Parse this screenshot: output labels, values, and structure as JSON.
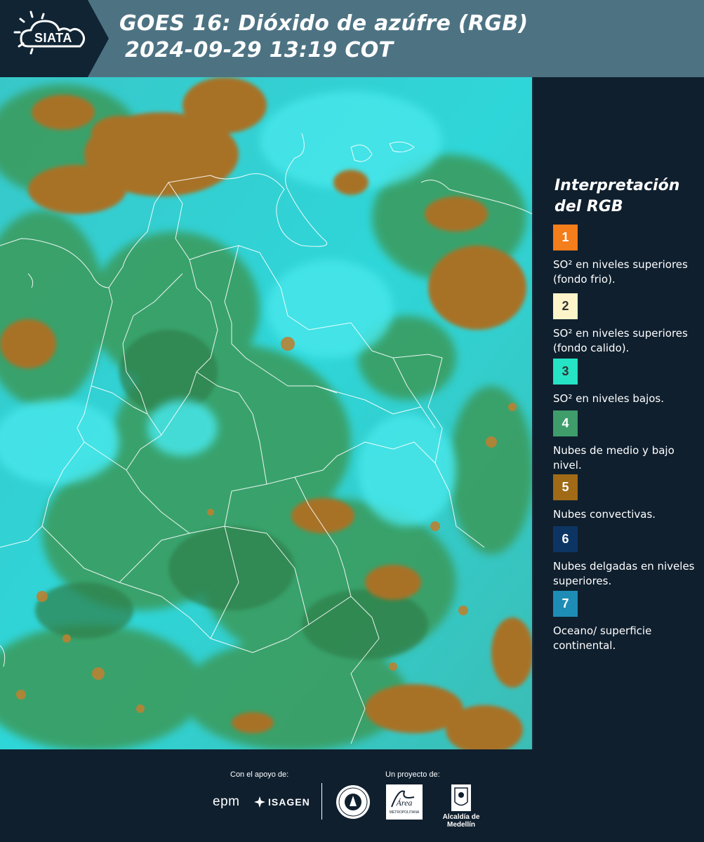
{
  "header": {
    "logo_text": "SIATA",
    "title": "GOES 16: Dióxido de azúfre (RGB)",
    "datetime": " 2024-09-29 13:19 COT"
  },
  "map": {
    "icon": "satellite-rgb-image"
  },
  "legend": {
    "title": "Interpretación del RGB",
    "items": [
      {
        "number": "1",
        "color": "#f47d1c",
        "text_color": "#ffffff",
        "label": "SO² en niveles superiores (fondo frio)."
      },
      {
        "number": "2",
        "color": "#fdf5c9",
        "text_color": "#333333",
        "label": "SO² en niveles superiores (fondo calido)."
      },
      {
        "number": "3",
        "color": "#25e3c4",
        "text_color": "#333333",
        "label": "SO² en niveles bajos."
      },
      {
        "number": "4",
        "color": "#3f9d6c",
        "text_color": "#ffffff",
        "label": "Nubes de medio y bajo nivel."
      },
      {
        "number": "5",
        "color": "#a06a17",
        "text_color": "#ffffff",
        "label": "Nubes convectivas."
      },
      {
        "number": "6",
        "color": "#0d3564",
        "text_color": "#ffffff",
        "label": "Nubes delgadas en niveles superiores."
      },
      {
        "number": "7",
        "color": "#1d8db6",
        "text_color": "#ffffff",
        "label": "Oceano/ superficie continental."
      }
    ]
  },
  "footer": {
    "support_caption": "Con el apoyo de:",
    "project_caption": "Un proyecto de:",
    "epm": "epm",
    "isagen": "ISAGEN",
    "area_name": "Área",
    "area_sub": "METROPOLITANA",
    "alcaldia": "Alcaldía de Medellín"
  },
  "colors": {
    "header_bg": "#4d7383",
    "panel_bg": "#0f1f2e",
    "cyan": "#2bd3d8",
    "green": "#3f9d6c",
    "brown": "#a0701f"
  }
}
